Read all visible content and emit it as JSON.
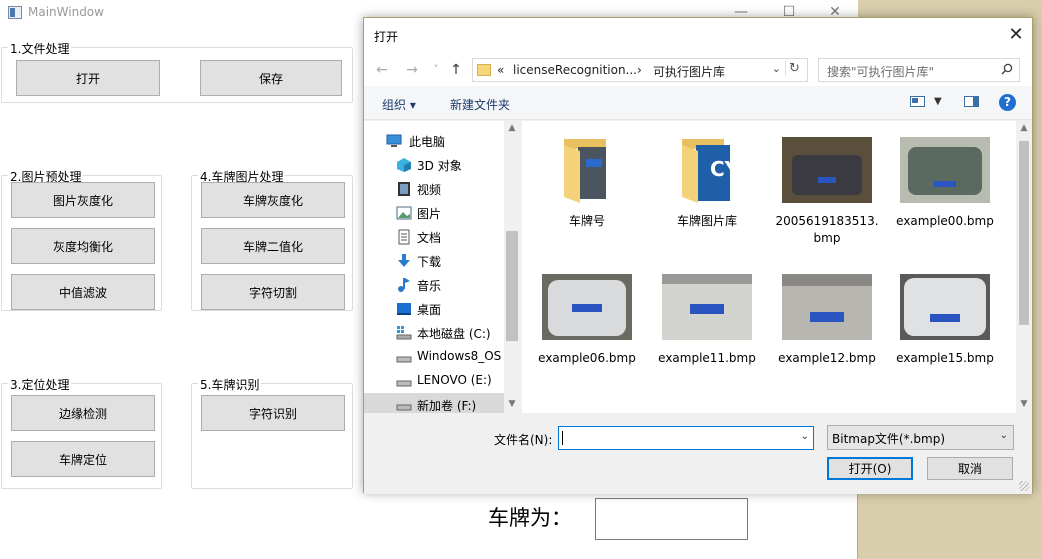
{
  "main_window": {
    "title": "MainWindow",
    "controls": {
      "minimize": "—",
      "maximize": "☐",
      "close": "✕"
    },
    "groups": {
      "file": {
        "title": "1.文件处理",
        "buttons": [
          "打开",
          "保存"
        ]
      },
      "preprocess": {
        "title": "2.图片预处理",
        "buttons": [
          "图片灰度化",
          "灰度均衡化",
          "中值滤波"
        ]
      },
      "plate_image": {
        "title": "4.车牌图片处理",
        "buttons": [
          "车牌灰度化",
          "车牌二值化",
          "字符切割"
        ]
      },
      "locate": {
        "title": "3.定位处理",
        "buttons": [
          "边缘检测",
          "车牌定位"
        ]
      },
      "recognize": {
        "title": "5.车牌识别",
        "buttons": [
          "字符识别"
        ]
      }
    },
    "plate_label": "车牌为：",
    "plate_value": ""
  },
  "dialog": {
    "title": "打开",
    "close": "✕",
    "nav": {
      "back": "←",
      "forward": "→",
      "recent": "˅",
      "up": "↑"
    },
    "address": {
      "prefix": "«",
      "segments": [
        "licenseRecognition...",
        "可执行图片库"
      ],
      "separator": "›",
      "refresh": "↻"
    },
    "search_placeholder": "搜索\"可执行图片库\"",
    "toolbar": {
      "organize": "组织 ▾",
      "new_folder": "新建文件夹",
      "help": "?"
    },
    "nav_pane": [
      {
        "label": "此电脑",
        "icon": "computer-icon",
        "root": true
      },
      {
        "label": "3D 对象",
        "icon": "3d-objects-icon"
      },
      {
        "label": "视频",
        "icon": "video-icon"
      },
      {
        "label": "图片",
        "icon": "pictures-icon"
      },
      {
        "label": "文档",
        "icon": "documents-icon"
      },
      {
        "label": "下载",
        "icon": "download-icon"
      },
      {
        "label": "音乐",
        "icon": "music-icon"
      },
      {
        "label": "桌面",
        "icon": "desktop-icon"
      },
      {
        "label": "本地磁盘 (C:)",
        "icon": "local-disk-icon"
      },
      {
        "label": "Windows8_OS",
        "icon": "drive-icon"
      },
      {
        "label": "LENOVO (E:)",
        "icon": "drive-icon"
      },
      {
        "label": "新加卷 (F:)",
        "icon": "drive-icon",
        "selected": true
      }
    ],
    "files": [
      {
        "name": "车牌号",
        "kind": "folder",
        "plate": "",
        "color": "#4a5560"
      },
      {
        "name": "车牌图片库",
        "kind": "folder",
        "plate": "CY",
        "color": "#1e5fa8"
      },
      {
        "name": "2005619183513.bmp",
        "kind": "image",
        "plate": "",
        "color": "#3a3a40"
      },
      {
        "name": "example00.bmp",
        "kind": "image",
        "plate": "",
        "color": "#5a6a60"
      },
      {
        "name": "example06.bmp",
        "kind": "image",
        "plate": "",
        "color": "#c9ccd0"
      },
      {
        "name": "example11.bmp",
        "kind": "image",
        "plate": "",
        "color": "#d3d3d0"
      },
      {
        "name": "example12.bmp",
        "kind": "image",
        "plate": "",
        "color": "#b8b6b0"
      },
      {
        "name": "example15.bmp",
        "kind": "image",
        "plate": "",
        "color": "#cfd2d4"
      }
    ],
    "filename_label": "文件名(N):",
    "filename_value": "",
    "filetype": "Bitmap文件(*.bmp)",
    "open_button": "打开(O)",
    "cancel_button": "取消"
  }
}
